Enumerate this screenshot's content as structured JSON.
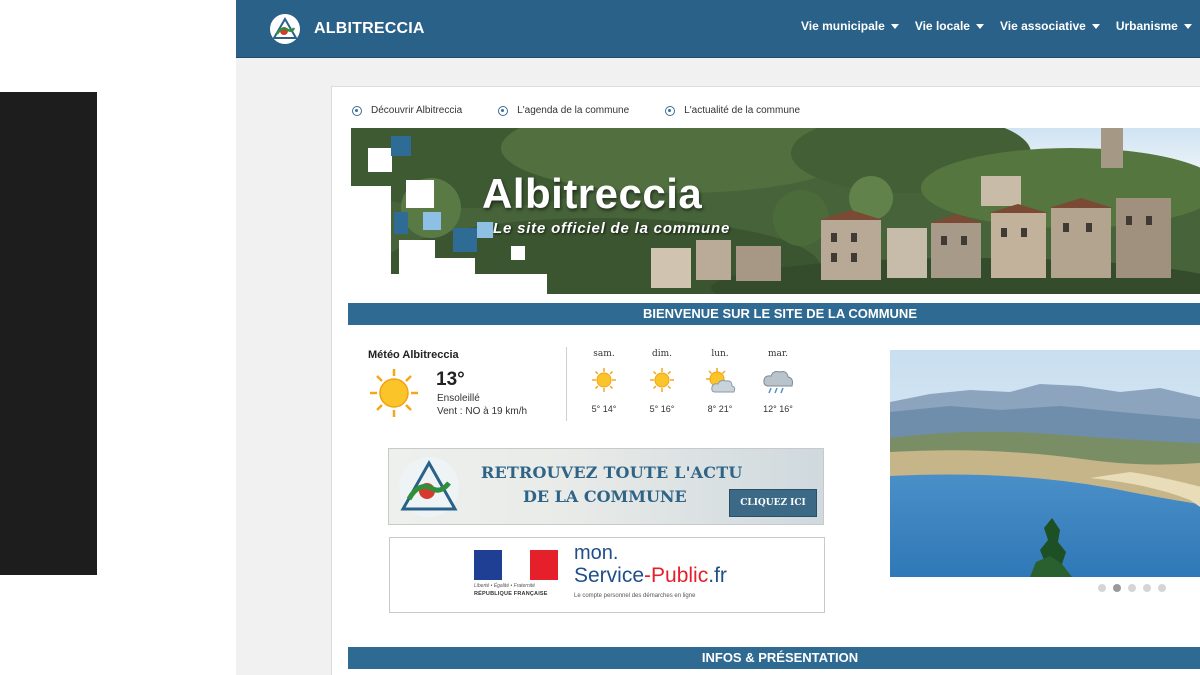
{
  "header": {
    "brand": "ALBITRECCIA",
    "menu": [
      {
        "label": "Vie municipale"
      },
      {
        "label": "Vie locale"
      },
      {
        "label": "Vie associative"
      },
      {
        "label": "Urbanisme"
      }
    ]
  },
  "quicklinks": [
    {
      "label": "Découvrir Albitreccia"
    },
    {
      "label": "L'agenda de la commune"
    },
    {
      "label": "L'actualité de la commune"
    }
  ],
  "banner": {
    "title": "Albitreccia",
    "subtitle": "Le site officiel de la commune"
  },
  "sections": {
    "welcome": "BIENVENUE SUR LE SITE DE LA COMMUNE",
    "infos": "INFOS & PRÉSENTATION"
  },
  "weather": {
    "title": "Météo Albitreccia",
    "temperature": "13°",
    "condition": "Ensoleillé",
    "wind": "Vent : NO à 19 km/h",
    "forecast": [
      {
        "day": "sam.",
        "temps": "5° 14°",
        "icon": "sun-icon"
      },
      {
        "day": "dim.",
        "temps": "5° 16°",
        "icon": "sun-icon"
      },
      {
        "day": "lun.",
        "temps": "8° 21°",
        "icon": "sun-cloud-icon"
      },
      {
        "day": "mar.",
        "temps": "12° 16°",
        "icon": "rain-cloud-icon"
      }
    ]
  },
  "ad_actu": {
    "line1": "RETROUVEZ TOUTE L'ACTU",
    "line2": "DE LA COMMUNE",
    "button": "CLIQUEZ ICI"
  },
  "ad_service_public": {
    "motto": "Liberté • Égalité • Fraternité",
    "republic": "RÉPUBLIQUE FRANÇAISE",
    "mon": "mon.",
    "service": "Service",
    "public": "-Public",
    "domain": ".fr",
    "caption": "Le compte personnel des démarches en ligne"
  },
  "slider": {
    "dot_count": 5,
    "active_dot": 2
  },
  "colors": {
    "navbar": "#2a6188",
    "section_bar": "#2f6a92",
    "accent_red": "#e5202b"
  }
}
